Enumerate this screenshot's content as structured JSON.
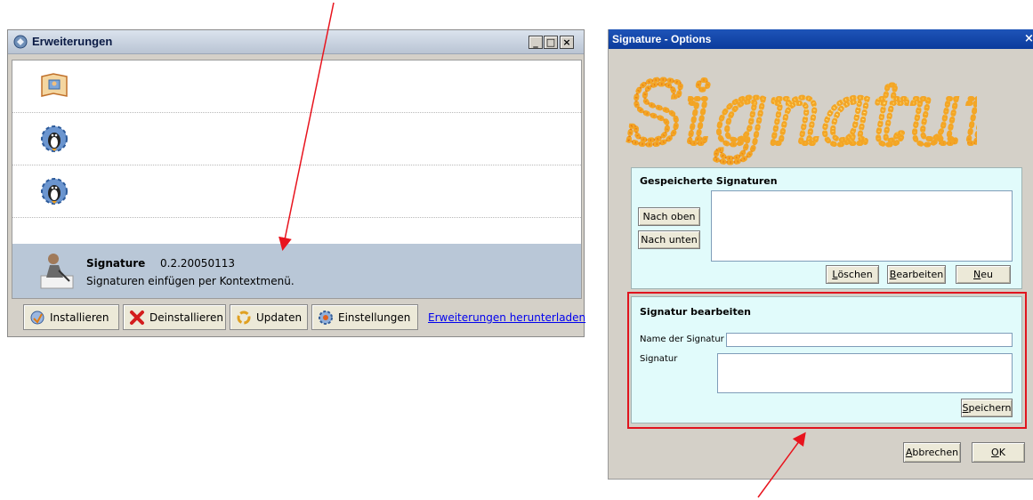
{
  "colors": {
    "arrow": "#e8141e",
    "highlight_border": "#e0141e",
    "panel_bg": "#e1fbfb",
    "selected_row": "#b9c7d7",
    "title_active": "#0b3b9c"
  },
  "win1": {
    "title": "Erweiterungen",
    "controls": [
      "_",
      "□",
      "×"
    ],
    "selected": {
      "name": "Signature",
      "version": "0.2.20050113",
      "description": "Signaturen einfügen per Kontextmenü."
    },
    "toolbar": [
      {
        "icon": "install-icon",
        "pre": "",
        "ul": "I",
        "post": "nstallieren"
      },
      {
        "icon": "uninstall-x-icon",
        "pre": "",
        "ul": "D",
        "post": "einstallieren"
      },
      {
        "icon": "update-icon",
        "pre": "",
        "ul": "U",
        "post": "pdaten"
      },
      {
        "icon": "settings-gear-icon",
        "pre": "",
        "ul": "E",
        "post": "instellungen"
      }
    ],
    "link": "Erweiterungen herunterladen"
  },
  "win2": {
    "title": "Signature - Options",
    "close": "×",
    "logo_text": "Signature",
    "saved": {
      "title": "Gespeicherte Signaturen",
      "up": "Nach oben",
      "down": "Nach unten",
      "del_ul": "L",
      "del_rest": "öschen",
      "edit_ul": "B",
      "edit_rest": "earbeiten",
      "new_ul": "N",
      "new_rest": "eu"
    },
    "edit": {
      "title": "Signatur bearbeiten",
      "name_label": "Name der Signatur",
      "sig_label": "Signatur",
      "save_ul": "S",
      "save_rest": "peichern"
    },
    "cancel_ul": "A",
    "cancel_rest": "bbrechen",
    "ok_ul": "O",
    "ok_rest": "K"
  }
}
